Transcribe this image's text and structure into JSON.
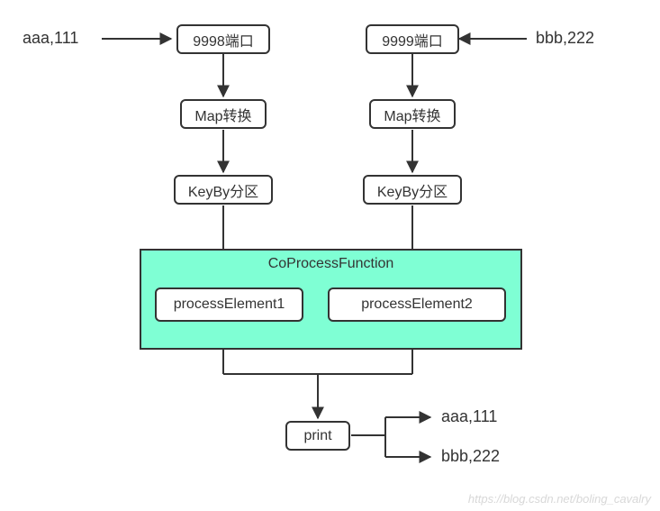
{
  "inputs": {
    "left": "aaa,111",
    "right": "bbb,222"
  },
  "nodes": {
    "port_left": "9998端口",
    "port_right": "9999端口",
    "map_left": "Map转换",
    "map_right": "Map转换",
    "keyby_left": "KeyBy分区",
    "keyby_right": "KeyBy分区",
    "coprocess_title": "CoProcessFunction",
    "process1": "processElement1",
    "process2": "processElement2",
    "print": "print"
  },
  "outputs": {
    "out1": "aaa,111",
    "out2": "bbb,222"
  },
  "watermark": "https://blog.csdn.net/boling_cavalry"
}
